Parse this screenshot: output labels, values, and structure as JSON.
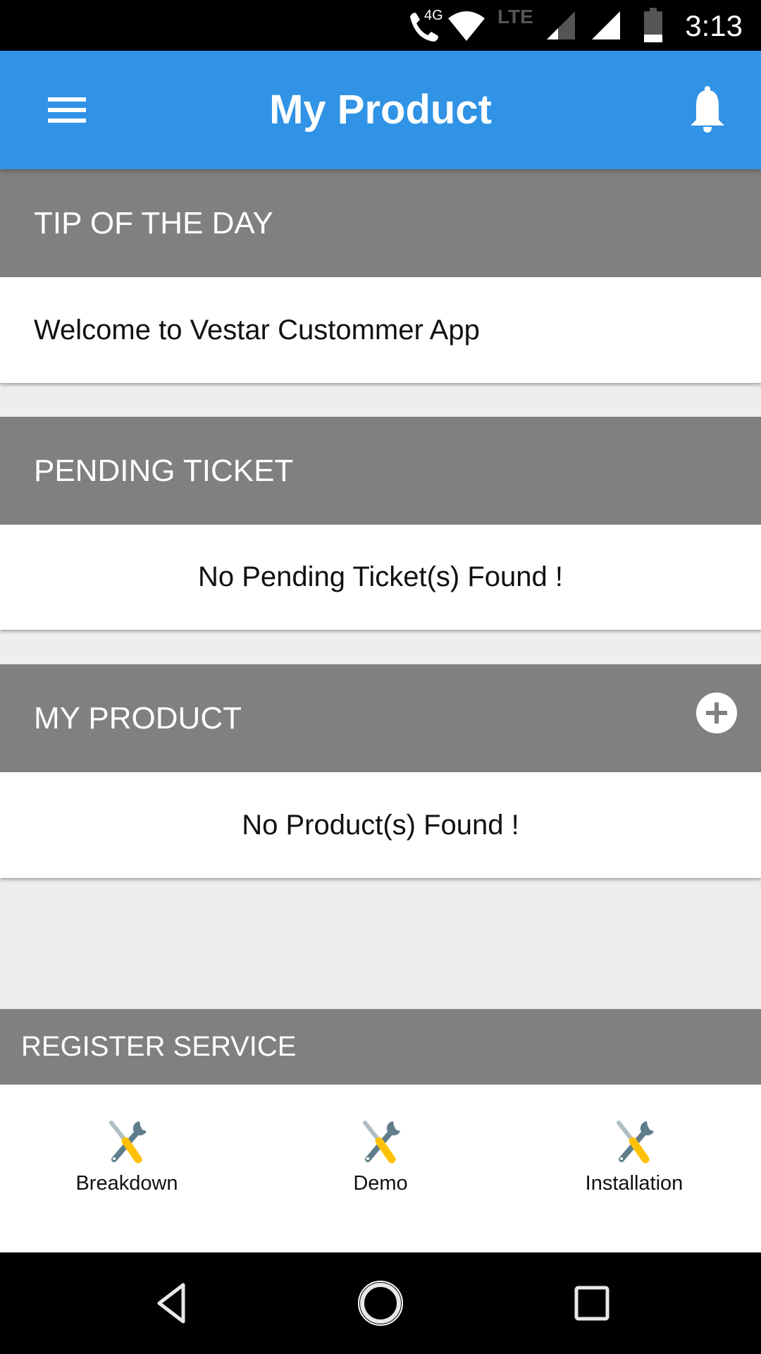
{
  "status_bar": {
    "time": "3:13",
    "call_badge": "4G",
    "network_type": "LTE",
    "icons": [
      "call-4g-icon",
      "wifi-icon",
      "lte-signal-icon",
      "signal-icon",
      "battery-icon"
    ]
  },
  "app_bar": {
    "title": "My Product",
    "menu_icon": "hamburger-menu-icon",
    "notification_icon": "bell-icon"
  },
  "sections": {
    "tip": {
      "header": "TIP OF THE DAY",
      "message": "Welcome to Vestar Custommer App"
    },
    "pending": {
      "header": "PENDING TICKET",
      "message": "No Pending Ticket(s) Found !"
    },
    "product": {
      "header": "MY PRODUCT",
      "message": "No Product(s) Found !",
      "add_icon": "add-circle-icon"
    },
    "register": {
      "header": "REGISTER SERVICE",
      "items": [
        {
          "label": "Breakdown",
          "icon": "tools-icon"
        },
        {
          "label": "Demo",
          "icon": "tools-icon"
        },
        {
          "label": "Installation",
          "icon": "tools-icon"
        }
      ]
    }
  },
  "nav_bar": {
    "buttons": [
      "back-icon",
      "home-icon",
      "recents-icon"
    ]
  },
  "colors": {
    "app_bar": "#3093e5",
    "section_header": "#808080",
    "background": "#eeeeee",
    "tool_handle": "#ffc107",
    "tool_metal": "#607d8b"
  }
}
